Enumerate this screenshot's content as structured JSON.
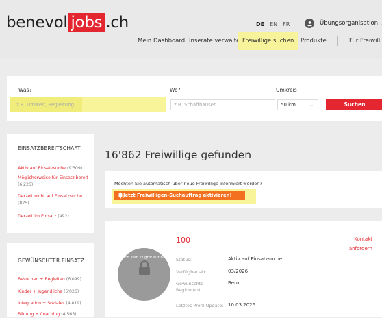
{
  "header": {
    "logo_left": "benevol",
    "logo_mid": "jobs",
    "logo_right": ".ch",
    "languages": [
      "DE",
      "EN",
      "FR"
    ],
    "active_language": "DE",
    "org_name": "Übungsorganisation",
    "nav": [
      "Mein Dashboard",
      "Inserate verwalten",
      "Freiwillige suchen",
      "Produkte",
      "Für Freiwillige"
    ],
    "active_nav": "Freiwillige suchen"
  },
  "search": {
    "was_label": "Was?",
    "was_placeholder": "z.B. Umwelt, Begleitung",
    "wo_label": "Wo?",
    "wo_placeholder": "z.B. Schaffhausen",
    "umkreis_label": "Umkreis",
    "umkreis_value": "50 km",
    "button": "Suchen"
  },
  "sidebar": {
    "readiness": {
      "heading": "EINSATZBEREITSCHAFT",
      "items": [
        {
          "label": "Aktiv auf Einsatzsuche",
          "count": "(9'309)"
        },
        {
          "label": "Möglicherweise für Einsatz bereit",
          "count": "(6'226)"
        },
        {
          "label": "Derzeit nicht auf Einsatzsuche",
          "count": "(825)"
        },
        {
          "label": "Derzeit im Einsatz",
          "count": "(492)"
        }
      ]
    },
    "desired": {
      "heading": "GEWÜNSCHTER EINSATZ",
      "items": [
        {
          "label": "Besuchen + Begleiten",
          "count": "(6'099)"
        },
        {
          "label": "Kinder + Jugendliche",
          "count": "(5'026)"
        },
        {
          "label": "Integration + Soziales",
          "count": "(4'819)"
        },
        {
          "label": "Bildung + Coaching",
          "count": "(4'563)"
        }
      ]
    }
  },
  "results": {
    "title": "16'862 Freiwillige gefunden",
    "alert_message": "Möchten Sie automatisch über neue Freiwillige informiert werden?",
    "alert_button": "Jetzt Freiwilligen-Suchauftrag aktivieren!"
  },
  "volunteer": {
    "photo_text": "Noch kein Zugriff auf Foto",
    "number": "100",
    "contact_line1": "Kontakt",
    "contact_line2": "anfordern",
    "status_label": "Status:",
    "status_value": "Aktiv auf Einsatzsuche",
    "available_label": "Verfügbar ab:",
    "available_value": "03/2026",
    "regions_label": "Gewünschte Region(en):",
    "regions_value": "Bern",
    "update_label": "Letztes Profil Update:",
    "update_value": "10.03.2026"
  },
  "colors": {
    "brand_red": "#e3262f",
    "highlight_yellow": "#f7f49a",
    "alert_orange": "#f37021"
  }
}
